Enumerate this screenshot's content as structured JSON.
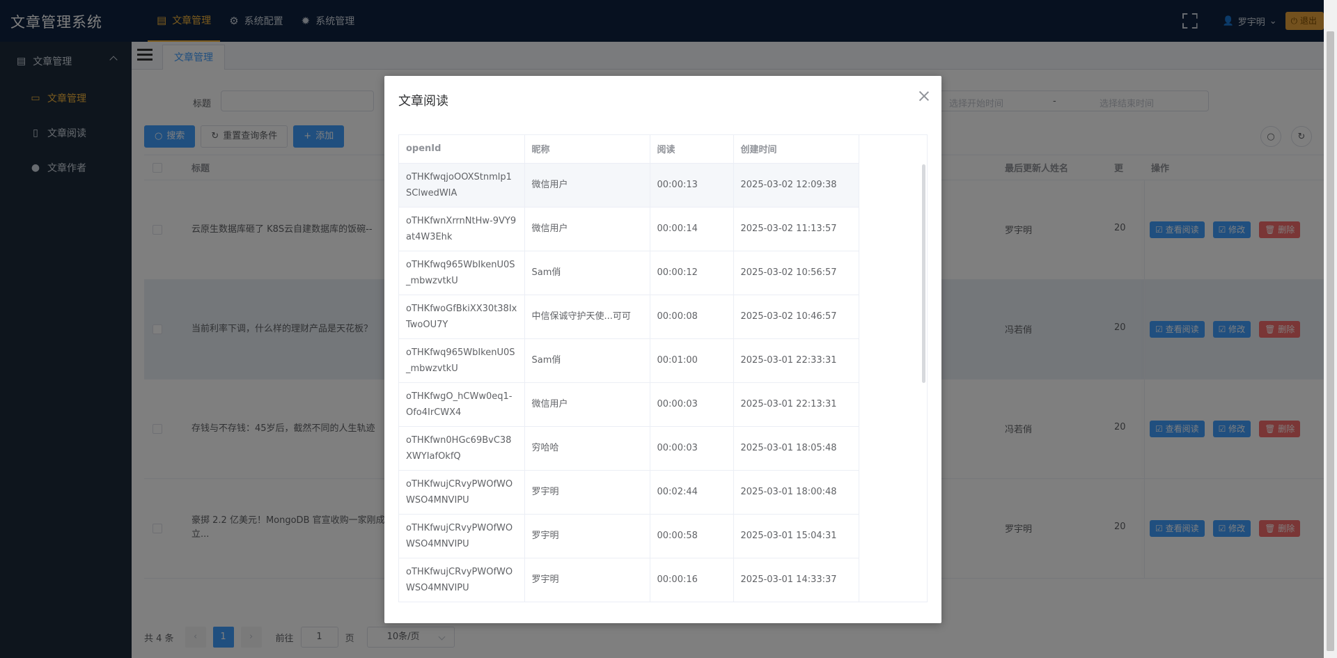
{
  "app": {
    "title": "文章管理系统"
  },
  "top_nav": [
    {
      "label": "文章管理",
      "icon": "document-icon",
      "active": true
    },
    {
      "label": "系统配置",
      "icon": "gear-icon",
      "active": false
    },
    {
      "label": "系统管理",
      "icon": "cog-icon",
      "active": false
    }
  ],
  "header": {
    "user": "罗宇明",
    "logout": "退出"
  },
  "sidebar": {
    "group": "文章管理",
    "items": [
      {
        "label": "文章管理",
        "active": true
      },
      {
        "label": "文章阅读",
        "active": false
      },
      {
        "label": "文章作者",
        "active": false
      }
    ]
  },
  "tabs": [
    {
      "label": "文章管理"
    }
  ],
  "filters": {
    "title_label": "标题",
    "start_placeholder": "选择开始时间",
    "range_sep": "-",
    "end_placeholder": "选择结束时间"
  },
  "buttons": {
    "search": "搜索",
    "reset": "重置查询条件",
    "add": "添加"
  },
  "table": {
    "columns": {
      "title": "标题",
      "updater": "最后更新人姓名",
      "upd": "更",
      "ops": "操作"
    },
    "rows": [
      {
        "title": "云原生数据库砸了 K8S云自建数据库的饭碗--",
        "updater": "罗宇明",
        "upd": "20"
      },
      {
        "title": "当前利率下调，什么样的理财产品是天花板？",
        "updater": "冯若俏",
        "upd": "20"
      },
      {
        "title": "存钱与不存钱：45岁后，截然不同的人生轨迹",
        "updater": "冯若俏",
        "upd": "20"
      },
      {
        "title": "豪掷 2.2 亿美元！MongoDB 官宣收购一家刚成立...",
        "updater": "罗宇明",
        "upd": "20"
      }
    ],
    "row_actions": {
      "view": "查看阅读",
      "edit": "修改",
      "delete": "删除"
    }
  },
  "pagination": {
    "total": "共 4 条",
    "current": "1",
    "goto_label": "前往",
    "goto_value": "1",
    "page_unit": "页",
    "page_size": "10条/页"
  },
  "modal": {
    "title": "文章阅读",
    "columns": [
      "openId",
      "昵称",
      "阅读",
      "创建时间"
    ],
    "rows": [
      {
        "openid": "oTHKfwqjoOOXStnmlp1SClwedWIA",
        "nick": "微信用户",
        "read": "00:00:13",
        "time": "2025-03-02 12:09:38"
      },
      {
        "openid": "oTHKfwnXrrnNtHw-9VY9at4W3Ehk",
        "nick": "微信用户",
        "read": "00:00:14",
        "time": "2025-03-02 11:13:57"
      },
      {
        "openid": "oTHKfwq965WbIkenU0S_mbwzvtkU",
        "nick": "Sam俏",
        "read": "00:00:12",
        "time": "2025-03-02 10:56:57"
      },
      {
        "openid": "oTHKfwoGfBkiXX30t38IxTwoOU7Y",
        "nick": "中信保诚守护天使...可可",
        "read": "00:00:08",
        "time": "2025-03-02 10:46:57"
      },
      {
        "openid": "oTHKfwq965WbIkenU0S_mbwzvtkU",
        "nick": "Sam俏",
        "read": "00:01:00",
        "time": "2025-03-01 22:33:31"
      },
      {
        "openid": "oTHKfwgO_hCWw0eq1-Ofo4IrCWX4",
        "nick": "微信用户",
        "read": "00:00:03",
        "time": "2025-03-01 22:13:31"
      },
      {
        "openid": "oTHKfwn0HGc69BvC38XWYIafOkfQ",
        "nick": "穷哈哈",
        "read": "00:00:03",
        "time": "2025-03-01 18:05:48"
      },
      {
        "openid": "oTHKfwujCRvyPWOfWOWSO4MNVIPU",
        "nick": "罗宇明",
        "read": "00:02:44",
        "time": "2025-03-01 18:00:48"
      },
      {
        "openid": "oTHKfwujCRvyPWOfWOWSO4MNVIPU",
        "nick": "罗宇明",
        "read": "00:00:58",
        "time": "2025-03-01 15:04:31"
      },
      {
        "openid": "oTHKfwujCRvyPWOfWOWSO4MNVIPU",
        "nick": "罗宇明",
        "read": "00:00:16",
        "time": "2025-03-01 14:33:37"
      }
    ]
  }
}
